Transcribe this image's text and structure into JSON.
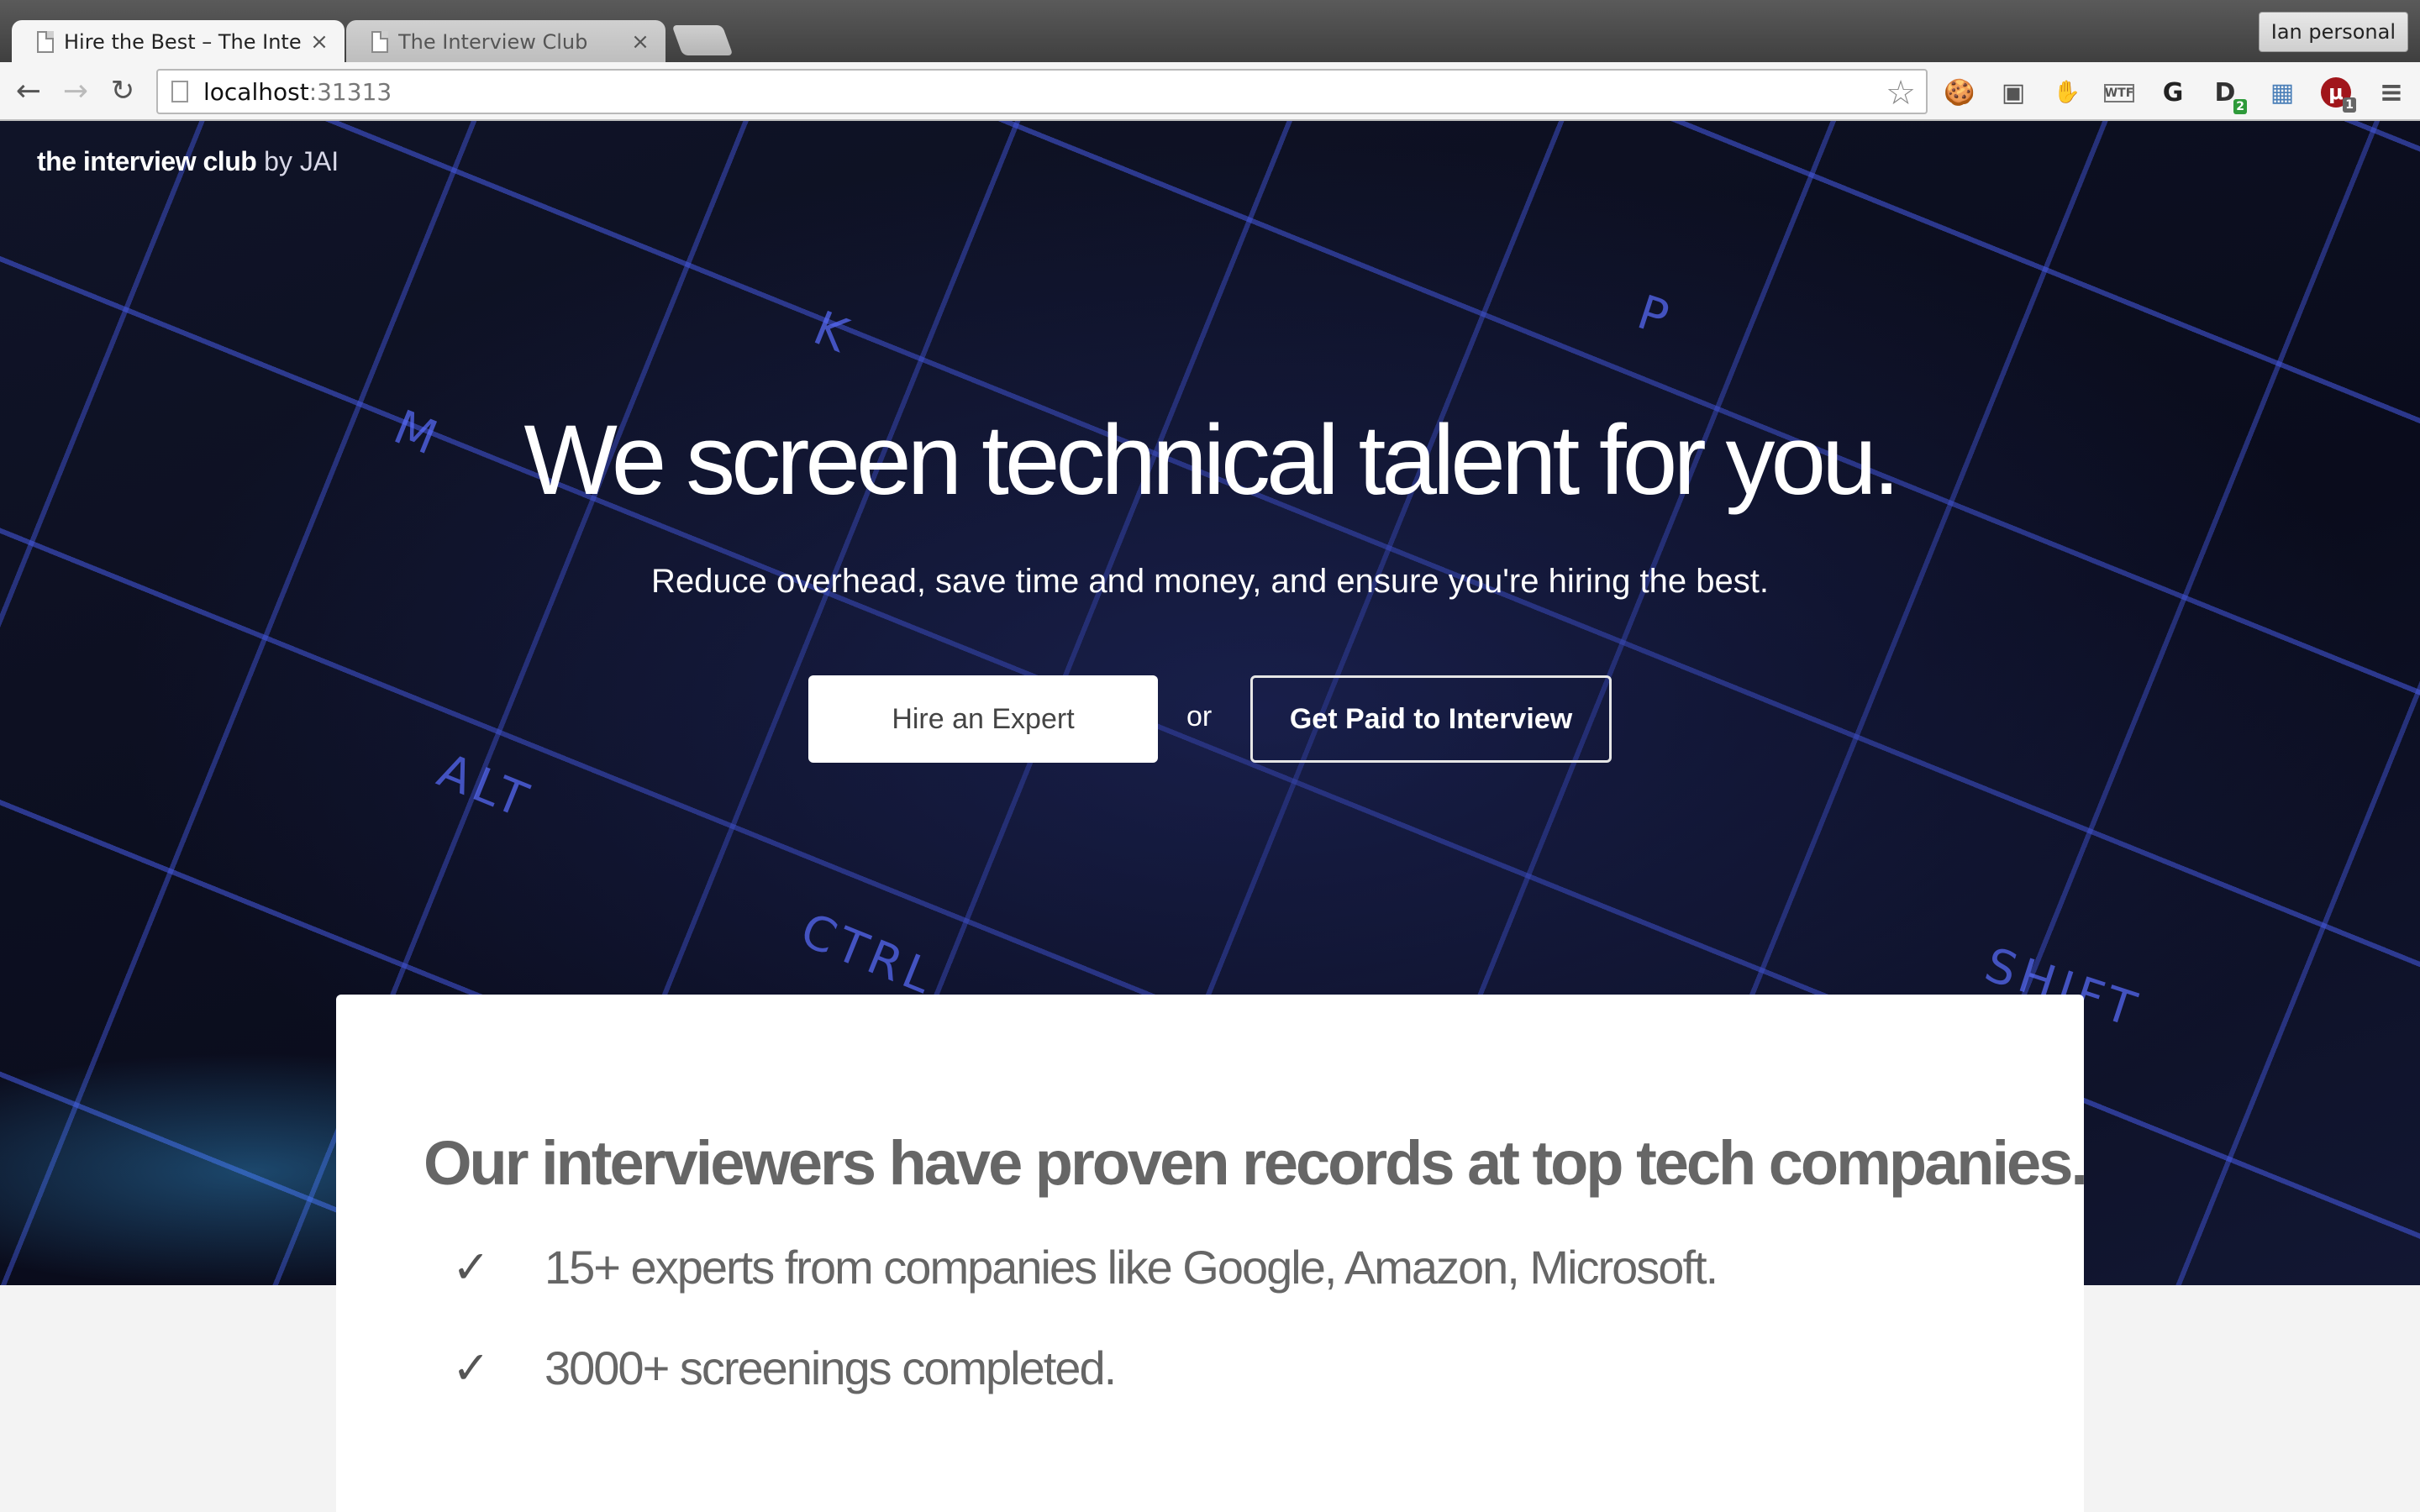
{
  "browser": {
    "tabs": [
      {
        "title": "Hire the Best – The Intervie",
        "active": true
      },
      {
        "title": "The Interview Club",
        "active": false
      }
    ],
    "profile_label": "Ian personal",
    "url_host": "localhost",
    "url_port": ":31313",
    "extensions": [
      {
        "icon": "cookie-icon",
        "glyph": "🍪"
      },
      {
        "icon": "window-icon",
        "glyph": "▣"
      },
      {
        "icon": "evernote-icon",
        "glyph": "✋"
      },
      {
        "icon": "wtf-icon",
        "glyph": "WTF"
      },
      {
        "icon": "google-icon",
        "glyph": "G"
      },
      {
        "icon": "d-extension-icon",
        "glyph": "D",
        "badge": "2",
        "badge_color": "#2e9a3a"
      },
      {
        "icon": "image-icon",
        "glyph": "▦"
      },
      {
        "icon": "ublock-icon",
        "glyph": "μ",
        "badge": "1",
        "badge_color": "#666666"
      }
    ]
  },
  "page": {
    "brand_main": "the interview club",
    "brand_by": " by JAI",
    "headline": "We screen technical talent for you.",
    "subhead": "Reduce overhead, save time and money, and ensure you're hiring the best.",
    "hire_button": "Hire an Expert",
    "or_text": "or",
    "paid_button": "Get Paid to Interview",
    "key_labels": [
      "ALT",
      "CTRL",
      "SHIFT",
      "M",
      "K",
      "P"
    ],
    "card": {
      "title": "Our interviewers have proven records at top tech companies.",
      "features": [
        "15+ experts from companies like Google, Amazon, Microsoft.",
        "3000+ screenings completed."
      ],
      "check_glyph": "✓"
    }
  },
  "colors": {
    "hero_bg": "#0d1020",
    "key_glow": "#4a5cff",
    "card_text": "#666666"
  }
}
